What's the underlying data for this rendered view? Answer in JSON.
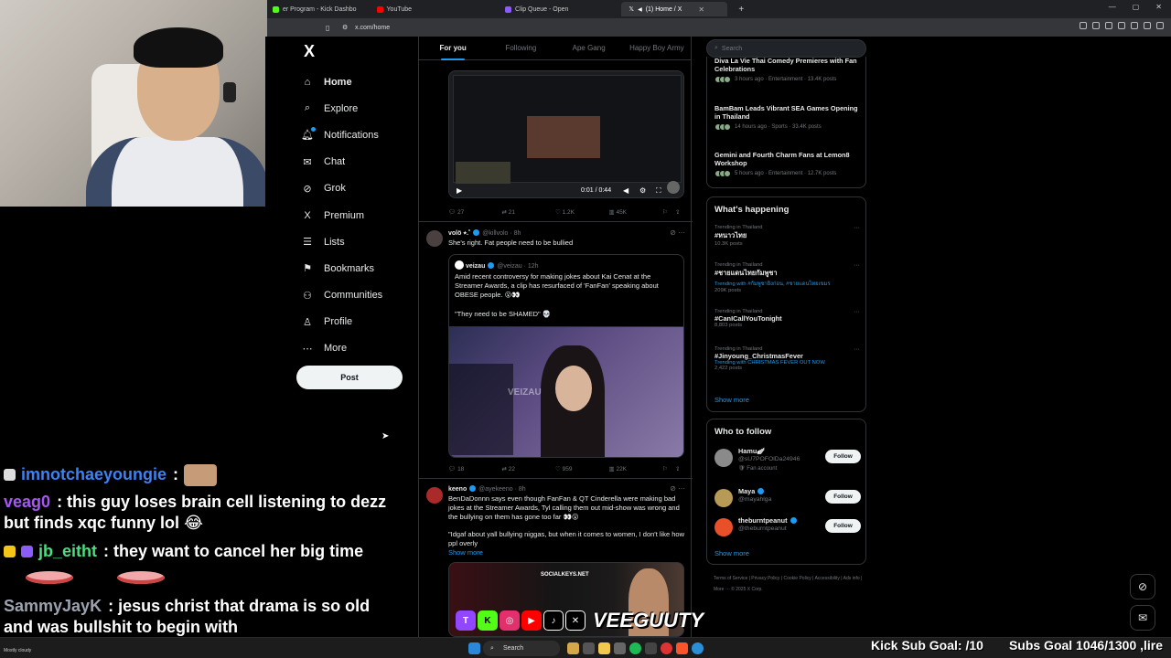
{
  "browser": {
    "tabs": [
      {
        "label": "er Program - Kick Dashbo",
        "color": "#53fc18"
      },
      {
        "label": "YouTube",
        "color": "#ff0000"
      },
      {
        "label": "Clip Queue - Open",
        "color": "#8b5cf6"
      },
      {
        "label": "(1) Home / X",
        "color": "#ffffff",
        "active": true
      }
    ],
    "url": "x.com/home"
  },
  "chat": {
    "messages": [
      {
        "user": "imnotchaeyoungie",
        "text": ":",
        "user_color": "#3b82f6"
      },
      {
        "user": "veag0",
        "text": ": this guy loses brain cell listening to dezz but finds xqc funny lol 😂",
        "user_color": "#a855f7"
      },
      {
        "user": "jb_eitht",
        "text": ": they want to cancel her big time",
        "user_color": "#4ade80"
      },
      {
        "user": "SammyJayK",
        "text": ": jesus christ that drama is so old and was bullshit to begin with",
        "user_color": "#9ca3af"
      }
    ]
  },
  "sidebar": {
    "logo": "X",
    "items": [
      {
        "label": "Home",
        "icon": "home-icon",
        "glyph": "⌂"
      },
      {
        "label": "Explore",
        "icon": "search-icon",
        "glyph": "⌕"
      },
      {
        "label": "Notifications",
        "icon": "bell-icon",
        "glyph": "♫"
      },
      {
        "label": "Chat",
        "icon": "mail-icon",
        "glyph": "✉"
      },
      {
        "label": "Grok",
        "icon": "grok-icon",
        "glyph": "⊘"
      },
      {
        "label": "Premium",
        "icon": "x-premium-icon",
        "glyph": "X"
      },
      {
        "label": "Lists",
        "icon": "list-icon",
        "glyph": "☰"
      },
      {
        "label": "Bookmarks",
        "icon": "bookmark-icon",
        "glyph": "⚑"
      },
      {
        "label": "Communities",
        "icon": "people-icon",
        "glyph": "⚇"
      },
      {
        "label": "Profile",
        "icon": "person-icon",
        "glyph": "♙"
      },
      {
        "label": "More",
        "icon": "more-circle-icon",
        "glyph": "⋯"
      }
    ],
    "post_label": "Post"
  },
  "feed": {
    "tabs": [
      "For you",
      "Following",
      "Ape Gang",
      "Happy Boy Army"
    ],
    "video": {
      "time": "0:01 / 0:44"
    },
    "tweet0_actions": {
      "replies": "27",
      "reposts": "21",
      "likes": "1.2K",
      "views": "45K"
    },
    "tweet1": {
      "name": "volö ⭑.˚",
      "handle": "@killvolo",
      "time": "· 8h",
      "text": "She's right. Fat people need to be bullied",
      "quote": {
        "name": "veizau",
        "handle": "@veizau · 12h",
        "text": "Amid recent controversy for making jokes about Kai Cenat at the Streamer Awards, a clip has resurfaced of 'FanFan' speaking about OBESE people. 😮👀",
        "text2": "\"They need to be SHAMED\" 💀",
        "watermark": "VEIZAU"
      },
      "actions": {
        "replies": "18",
        "reposts": "22",
        "likes": "959",
        "views": "22K"
      }
    },
    "tweet2": {
      "name": "keeno",
      "handle": "@ayekeeno",
      "time": "· 8h",
      "text": "BenDaDonnn says even though FanFan & QT Cinderella were making bad jokes at the Streamer Awards, Tyl calling them out mid-show was wrong and the bullying on them has gone too far 👀😮",
      "text2": "\"Idgaf about yall bullying niggas, but when it comes to women, I don't like how ppl overly",
      "show_more": "Show more",
      "media_tag": "SOCIALKEYS.NET"
    }
  },
  "right": {
    "search_placeholder": "Search",
    "news": [
      {
        "title": "Diva La Vie Thai Comedy Premieres with Fan Celebrations",
        "meta": "3 hours ago · Entertainment · 13.4K posts"
      },
      {
        "title": "BamBam Leads Vibrant SEA Games Opening in Thailand",
        "meta": "14 hours ago · Sports · 33.4K posts"
      },
      {
        "title": "Gemini and Fourth Charm Fans at Lemon8 Workshop",
        "meta": "5 hours ago · Entertainment · 12.7K posts"
      }
    ],
    "happening_title": "What's happening",
    "trends": [
      {
        "context": "Trending in Thailand",
        "name": "#หนาวไทย",
        "count": "10.3K posts",
        "with": ""
      },
      {
        "context": "Trending in Thailand",
        "name": "#ชายแดนไทยกัมพูชา",
        "count": "209K posts",
        "with": "Trending with #กัมพูชายิงก่อน, #ชายแดนไทยเขมร"
      },
      {
        "context": "Trending in Thailand",
        "name": "#CanICallYouTonight",
        "count": "8,803 posts",
        "with": ""
      },
      {
        "context": "Trending in Thailand",
        "name": "#Jinyoung_ChristmasFever",
        "count": "2,422 posts",
        "with": "Trending with CHRISTMAS FEVER OUT NOW"
      }
    ],
    "show_more": "Show more",
    "follow_title": "Who to follow",
    "follows": [
      {
        "name": "Hamu🪽",
        "handle": "@sU7POFOlDa24946",
        "extra": "🛡 Fan account",
        "color": "#8a8a8a"
      },
      {
        "name": "Maya",
        "handle": "@mayahlga",
        "extra": "",
        "color": "#b79a55"
      },
      {
        "name": "theburntpeanut",
        "handle": "@theburntpeanut",
        "extra": "",
        "color": "#e8502a"
      }
    ],
    "follow_label": "Follow",
    "footer": "Terms of Service  |  Privacy Policy  |  Cookie Policy  |  Accessibility  |  Ads info  |  More ···  © 2025 X Corp."
  },
  "overlay": {
    "sub_goal": "Kick Sub Goal: /10",
    "subs_goal": "Subs Goal 1046/1300 ,lire",
    "brand": "VEEGUUTY",
    "taskbar_search": "Search",
    "weather": "Mostly cloudy"
  }
}
